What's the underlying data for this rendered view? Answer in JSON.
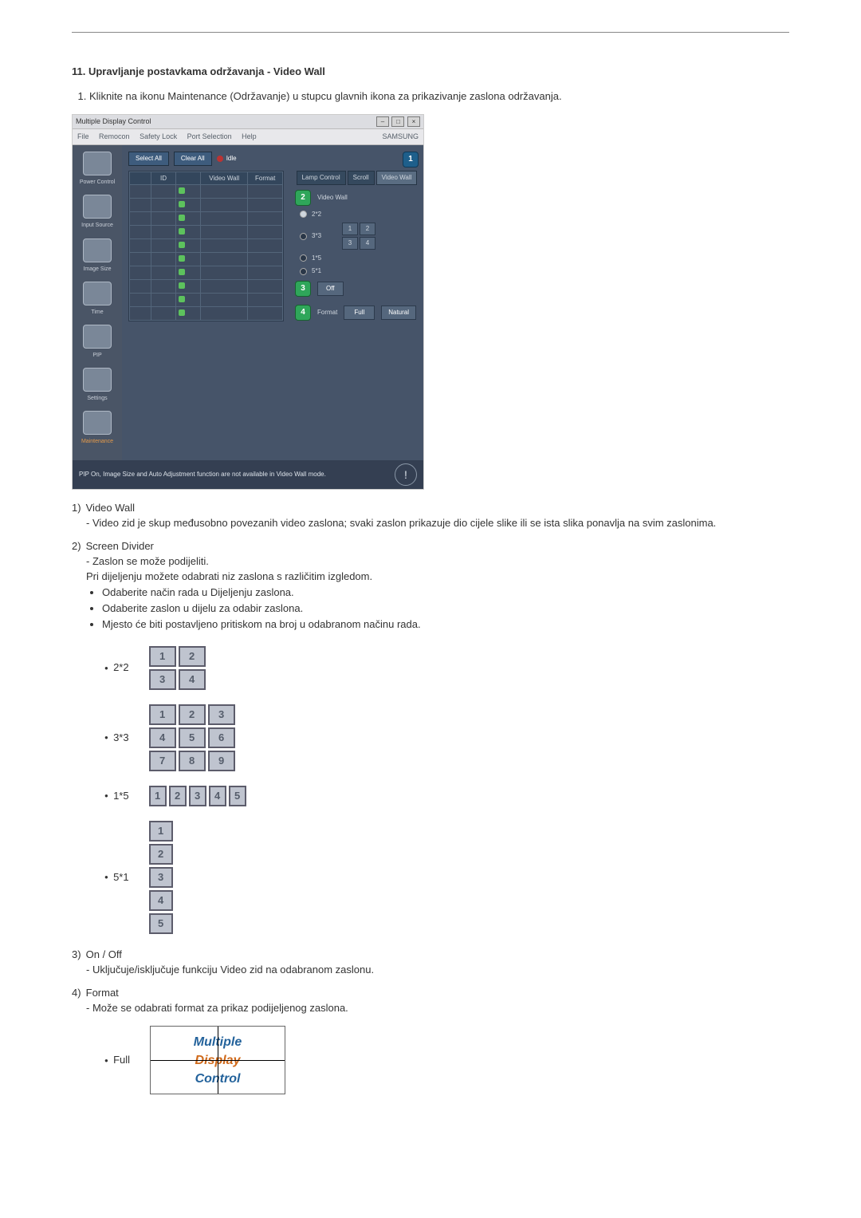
{
  "section": {
    "heading": "11. Upravljanje postavkama održavanja - Video Wall",
    "step1": "Kliknite na ikonu Maintenance (Održavanje) u stupcu glavnih ikona za prikazivanje zaslona održavanja."
  },
  "shot": {
    "title": "Multiple Display Control",
    "menus": [
      "File",
      "Remocon",
      "Safety Lock",
      "Port Selection",
      "Help"
    ],
    "brand": "SAMSUNG",
    "topbar": {
      "select_all": "Select All",
      "clear_all": "Clear All",
      "idle": "Idle"
    },
    "sidebar": [
      {
        "label": "Power Control"
      },
      {
        "label": "Input Source"
      },
      {
        "label": "Image Size"
      },
      {
        "label": "Time"
      },
      {
        "label": "PIP"
      },
      {
        "label": "Settings"
      },
      {
        "label": "Maintenance",
        "selected": true
      }
    ],
    "table_headers": [
      "",
      "ID",
      "",
      "Video Wall",
      "Format"
    ],
    "right": {
      "tabs": [
        "Lamp Control",
        "Scroll",
        "Video Wall"
      ],
      "panel_title": "Video Wall",
      "opts": [
        "2*2",
        "3*3",
        "1*5",
        "5*1"
      ],
      "off": "Off",
      "format": "Format",
      "full": "Full",
      "natural": "Natural"
    },
    "status": "PIP On, Image Size and Auto Adjustment function are not available in Video Wall mode."
  },
  "items": {
    "i1": {
      "title": "Video Wall",
      "p1": "Video zid je skup međusobno povezanih video zaslona; svaki zaslon prikazuje dio cijele slike ili se ista slika ponavlja na svim zaslonima."
    },
    "i2": {
      "title": "Screen Divider",
      "p1": "Zaslon se može podijeliti.",
      "p2": "Pri dijeljenju možete odabrati niz zaslona s različitim izgledom.",
      "b1": "Odaberite način rada u Dijeljenju zaslona.",
      "b2": "Odaberite zaslon u dijelu za odabir zaslona.",
      "b3": "Mjesto će biti postavljeno pritiskom na broj u odabranom načinu rada."
    },
    "i3": {
      "title": "On / Off",
      "p1": "Uključuje/isključuje funkciju Video zid na odabranom zaslonu."
    },
    "i4": {
      "title": "Format",
      "p1": "Može se odabrati format za prikaz podijeljenog zaslona."
    }
  },
  "layouts": {
    "l22": "2*2",
    "l33": "3*3",
    "l15": "1*5",
    "l51": "5*1",
    "full": "Full"
  },
  "fullimg": {
    "l1": "Multiple",
    "l2": "Display",
    "l3": "Control"
  }
}
